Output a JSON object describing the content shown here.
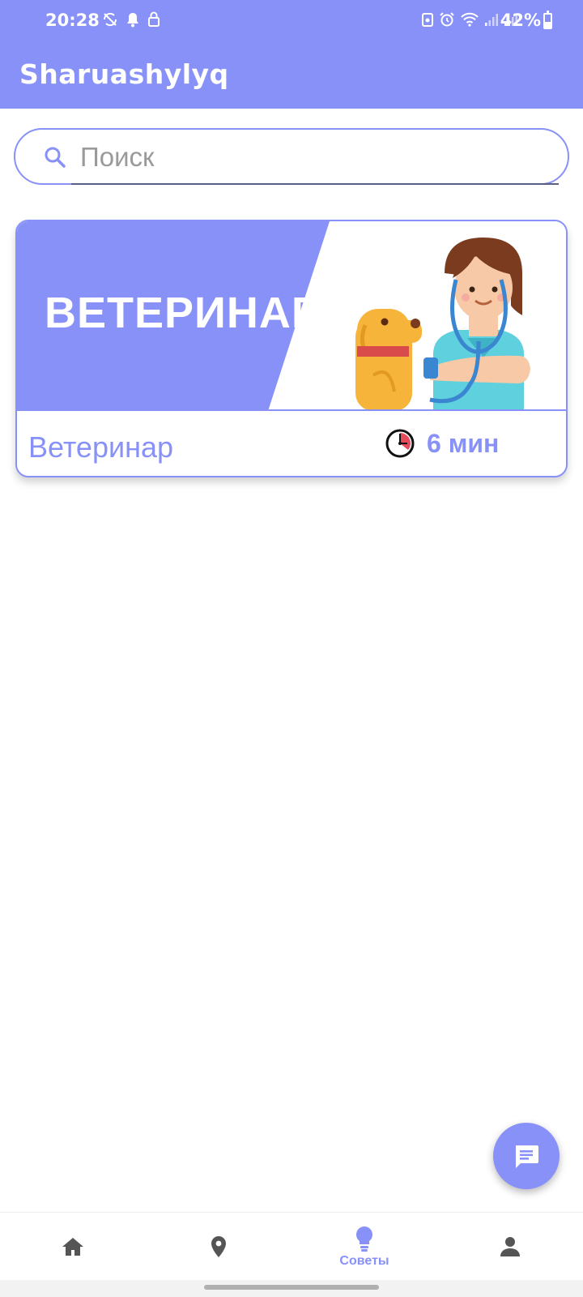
{
  "status_bar": {
    "time": "20:28",
    "battery": "42%"
  },
  "app": {
    "title": "Sharuashylyq"
  },
  "search": {
    "placeholder": "Поиск",
    "value": ""
  },
  "card": {
    "banner_text": "ВЕТЕРИНАР",
    "title": "Ветеринар",
    "read_time_value": "6",
    "read_time_unit": "мин"
  },
  "bottom_nav": {
    "items": [
      {
        "icon": "home-icon",
        "label": ""
      },
      {
        "icon": "location-pin-icon",
        "label": ""
      },
      {
        "icon": "lightbulb-icon",
        "label": "Советы",
        "active": true
      },
      {
        "icon": "person-icon",
        "label": ""
      }
    ]
  },
  "colors": {
    "accent": "#8891f7",
    "nav_inactive": "#555555",
    "background": "#ffffff"
  }
}
